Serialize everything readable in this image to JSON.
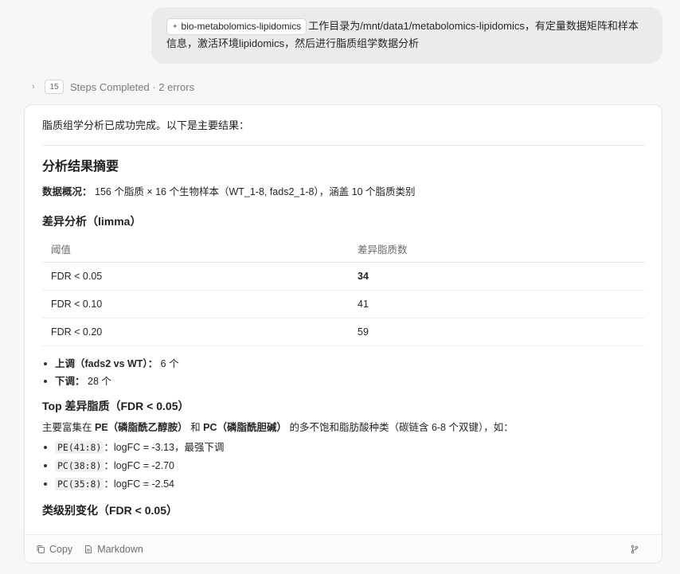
{
  "user_message": {
    "skill_chip": "bio-metabolomics-lipidomics",
    "text": "工作目录为/mnt/data1/metabolomics-lipidomics，有定量数据矩阵和样本信息，激活环境lipidomics，然后进行脂质组学数据分析"
  },
  "steps": {
    "count": "15",
    "label": "Steps Completed · 2 errors"
  },
  "response": {
    "intro": "脂质组学分析已成功完成。以下是主要结果：",
    "summary_title": "分析结果摘要",
    "overview_label": "数据概况：",
    "overview_text": " 156 个脂质 × 16 个生物样本（WT_1-8, fads2_1-8），涵盖 10 个脂质类别",
    "limma_title": "差异分析（limma）",
    "table": {
      "headers": [
        "阈值",
        "差异脂质数"
      ],
      "rows": [
        {
          "threshold": "FDR < 0.05",
          "count": "34"
        },
        {
          "threshold": "FDR < 0.10",
          "count": "41"
        },
        {
          "threshold": "FDR < 0.20",
          "count": "59"
        }
      ]
    },
    "direction": [
      {
        "label": "上调（fads2 vs WT）：",
        "value": " 6 个"
      },
      {
        "label": "下调：",
        "value": " 28 个"
      }
    ],
    "top_title": "Top 差异脂质（FDR < 0.05）",
    "top_para": {
      "prefix": "主要富集在 ",
      "pe": "PE（磷脂酰乙醇胺）",
      "mid": " 和 ",
      "pc": "PC（磷脂酰胆碱）",
      "suffix": " 的多不饱和脂肪酸种类（碳链含 6-8 个双键），如："
    },
    "top_lipids": [
      {
        "name": "PE(41:8)",
        "desc": "：logFC = -3.13，最强下调"
      },
      {
        "name": "PC(38:8)",
        "desc": "：logFC = -2.70"
      },
      {
        "name": "PC(35:8)",
        "desc": "：logFC = -2.54"
      }
    ],
    "class_title": "类级别变化（FDR < 0.05）"
  },
  "footer": {
    "copy_label": "Copy",
    "markdown_label": "Markdown"
  },
  "icons": {
    "chip": "sparkle-icon",
    "copy": "copy-icon",
    "markdown": "document-icon",
    "branch": "branch-icon"
  }
}
